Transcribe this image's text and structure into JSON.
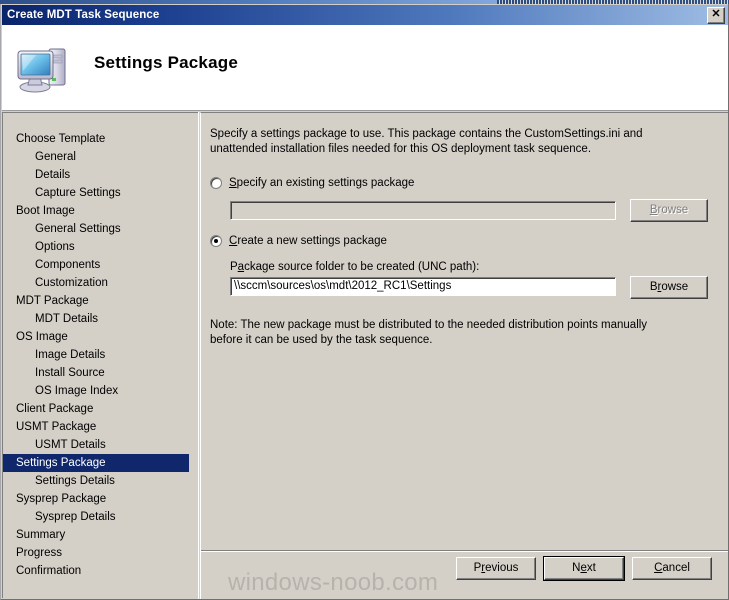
{
  "window": {
    "title": "Create MDT Task Sequence",
    "close_label": "✕",
    "close_icon": "close-icon"
  },
  "header": {
    "title": "Settings Package",
    "icon": "computer-monitor-icon"
  },
  "sidebar": {
    "items": [
      {
        "label": "Choose Template",
        "level": 1,
        "selected": false
      },
      {
        "label": "General",
        "level": 2,
        "selected": false
      },
      {
        "label": "Details",
        "level": 2,
        "selected": false
      },
      {
        "label": "Capture Settings",
        "level": 2,
        "selected": false
      },
      {
        "label": "Boot Image",
        "level": 1,
        "selected": false
      },
      {
        "label": "General Settings",
        "level": 2,
        "selected": false
      },
      {
        "label": "Options",
        "level": 2,
        "selected": false
      },
      {
        "label": "Components",
        "level": 2,
        "selected": false
      },
      {
        "label": "Customization",
        "level": 2,
        "selected": false
      },
      {
        "label": "MDT Package",
        "level": 1,
        "selected": false
      },
      {
        "label": "MDT Details",
        "level": 2,
        "selected": false
      },
      {
        "label": "OS Image",
        "level": 1,
        "selected": false
      },
      {
        "label": "Image Details",
        "level": 2,
        "selected": false
      },
      {
        "label": "Install Source",
        "level": 2,
        "selected": false
      },
      {
        "label": "OS Image Index",
        "level": 2,
        "selected": false
      },
      {
        "label": "Client Package",
        "level": 1,
        "selected": false
      },
      {
        "label": "USMT Package",
        "level": 1,
        "selected": false
      },
      {
        "label": "USMT Details",
        "level": 2,
        "selected": false
      },
      {
        "label": "Settings Package",
        "level": 1,
        "selected": true
      },
      {
        "label": "Settings Details",
        "level": 2,
        "selected": false
      },
      {
        "label": "Sysprep Package",
        "level": 1,
        "selected": false
      },
      {
        "label": "Sysprep Details",
        "level": 2,
        "selected": false
      },
      {
        "label": "Summary",
        "level": 1,
        "selected": false
      },
      {
        "label": "Progress",
        "level": 1,
        "selected": false
      },
      {
        "label": "Confirmation",
        "level": 1,
        "selected": false
      }
    ],
    "selected_color": "#10276b"
  },
  "main": {
    "intro": "Specify a settings package to use.  This package contains the CustomSettings.ini and unattended installation files needed for this OS deployment task sequence.",
    "option_existing": {
      "label": "Specify an existing settings package",
      "checked": false,
      "textbox_value": "",
      "textbox_enabled": false,
      "browse_label": "Browse",
      "browse_enabled": false
    },
    "option_new": {
      "label": "Create a new settings package",
      "checked": true,
      "field_label": "Package source folder to be created (UNC path):",
      "textbox_value": "\\\\sccm\\sources\\os\\mdt\\2012_RC1\\Settings",
      "textbox_enabled": true,
      "browse_label": "Browse",
      "browse_enabled": true
    },
    "note": "Note: The new package must be distributed to the needed distribution points manually before it can be used by the task sequence."
  },
  "footer": {
    "previous_label": "Previous",
    "next_label": "Next",
    "cancel_label": "Cancel",
    "default_button": "Next"
  },
  "watermark": {
    "text": "windows-noob.com",
    "color": "#b6b3ac"
  }
}
